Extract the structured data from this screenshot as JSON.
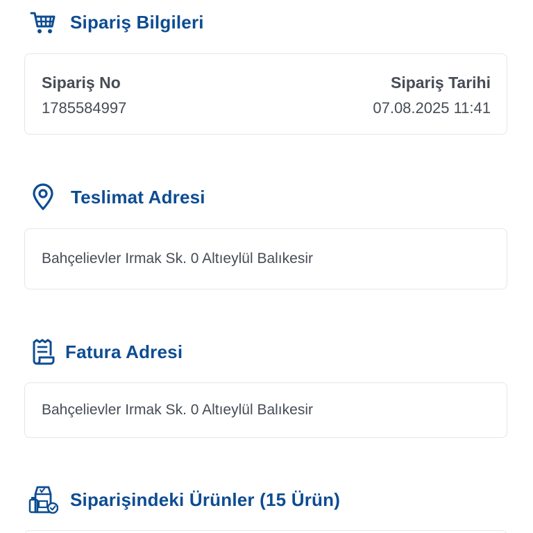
{
  "order_section": {
    "title": "Sipariş Bilgileri",
    "icon": "shopping-cart-icon",
    "order_no_label": "Sipariş No",
    "order_no_value": "1785584997",
    "order_date_label": "Sipariş Tarihi",
    "order_date_value": "07.08.2025 11:41"
  },
  "delivery_section": {
    "title": "Teslimat Adresi",
    "icon": "location-pin-icon",
    "address": "Bahçelievler Irmak Sk. 0 Altıeylül Balıkesir"
  },
  "invoice_section": {
    "title": "Fatura Adresi",
    "icon": "receipt-icon",
    "address": "Bahçelievler Irmak Sk. 0 Altıeylül Balıkesir"
  },
  "products_section": {
    "title": "Siparişindeki Ürünler (15 Ürün)",
    "icon": "groceries-icon"
  },
  "colors": {
    "accent": "#0d4c92",
    "text": "#464c55",
    "border": "#e3e6ea"
  }
}
